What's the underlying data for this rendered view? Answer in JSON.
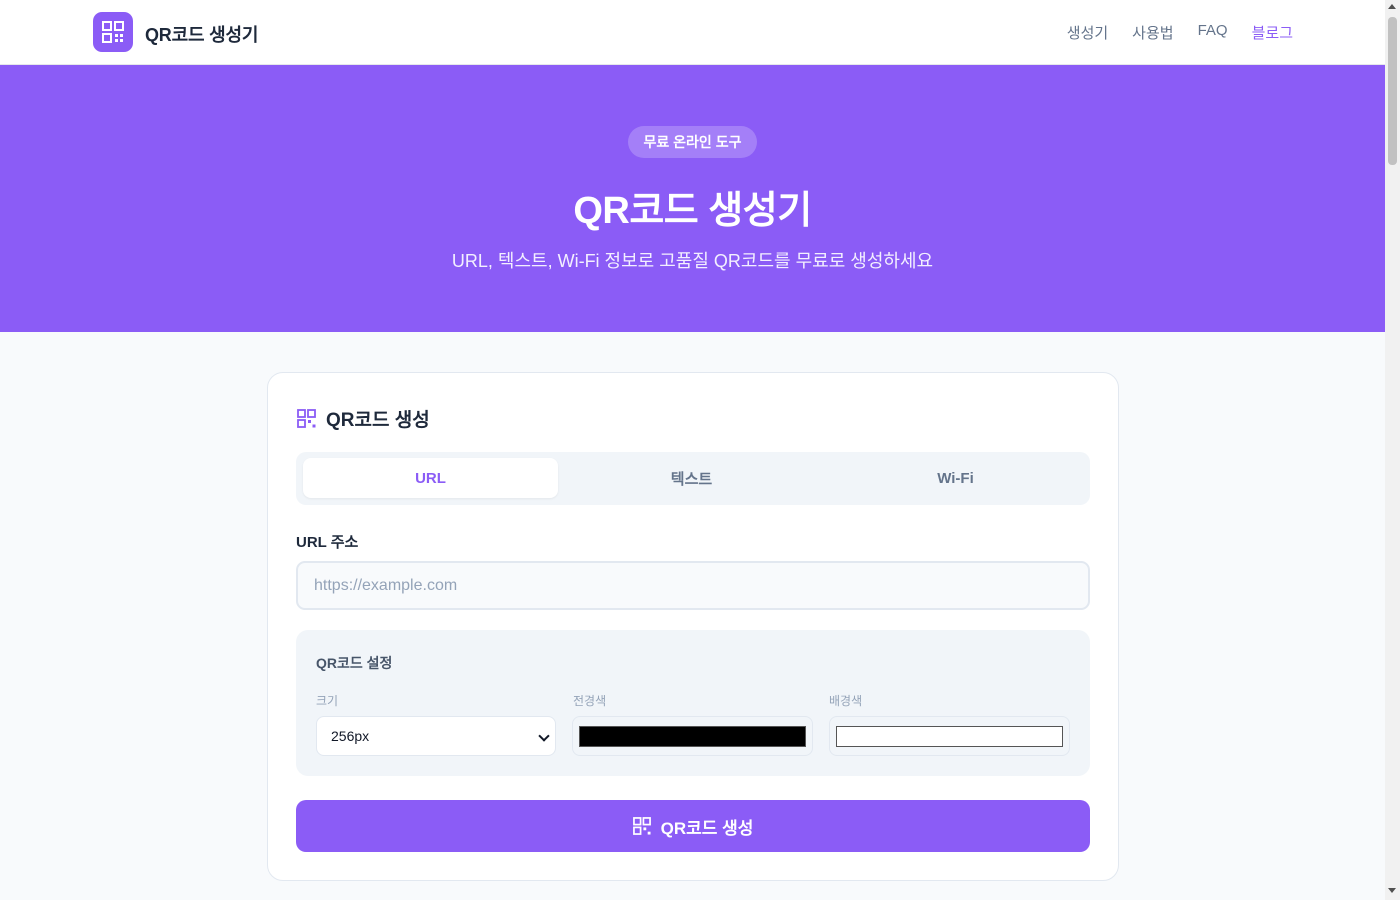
{
  "header": {
    "brand": "QR코드 생성기",
    "logo_icon": "qr-code-icon",
    "nav": [
      {
        "label": "생성기",
        "active": false
      },
      {
        "label": "사용법",
        "active": false
      },
      {
        "label": "FAQ",
        "active": false
      },
      {
        "label": "블로그",
        "active": true
      }
    ]
  },
  "hero": {
    "badge": "무료 온라인 도구",
    "title": "QR코드 생성기",
    "subtitle": "URL, 텍스트, Wi-Fi 정보로 고품질 QR코드를 무료로 생성하세요"
  },
  "card": {
    "title": "QR코드 생성",
    "title_icon": "qr-code-icon",
    "tabs": [
      {
        "label": "URL",
        "active": true
      },
      {
        "label": "텍스트",
        "active": false
      },
      {
        "label": "Wi-Fi",
        "active": false
      }
    ],
    "url_field": {
      "label": "URL 주소",
      "placeholder": "https://example.com",
      "value": ""
    },
    "settings": {
      "title": "QR코드 설정",
      "size_label": "크기",
      "size_value": "256px",
      "foreground_label": "전경색",
      "foreground_color": "#000000",
      "background_label": "배경색",
      "background_color": "#ffffff"
    },
    "generate_button": "QR코드 생성"
  },
  "colors": {
    "accent": "#8b5cf6",
    "page_background": "#f8fafc",
    "text_dark": "#1e293b",
    "text_muted": "#64748b"
  }
}
